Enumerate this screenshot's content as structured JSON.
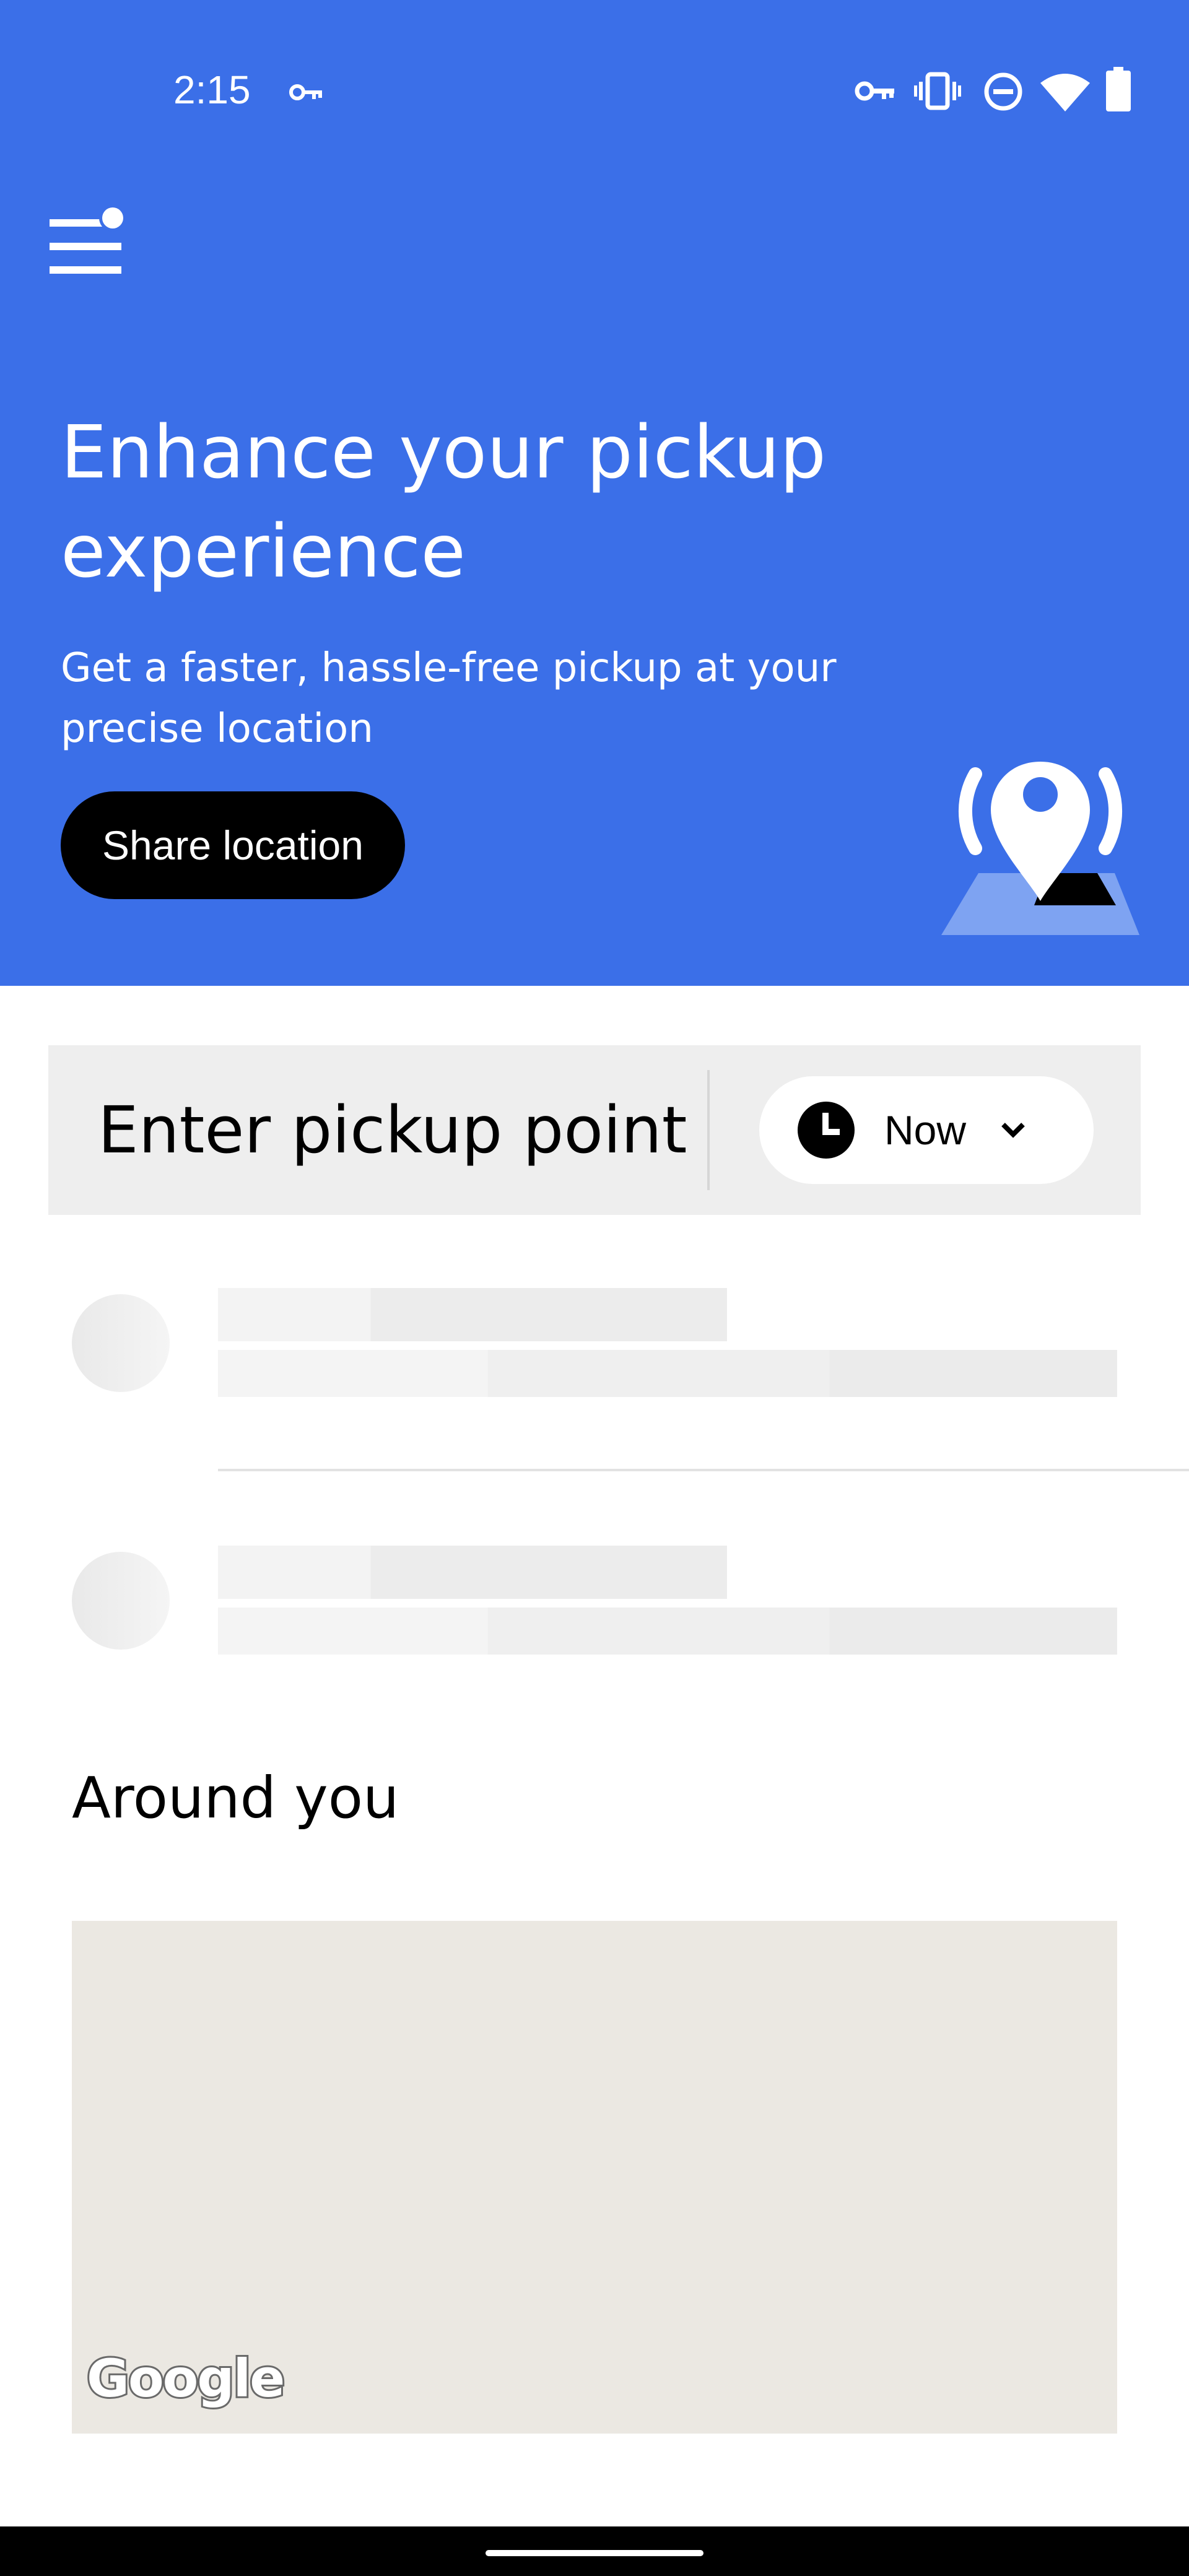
{
  "status_bar": {
    "time": "2:15",
    "icons": [
      "vpn-key-icon",
      "vpn-key-icon",
      "vibrate-icon",
      "do-not-disturb-icon",
      "wifi-icon",
      "battery-icon"
    ]
  },
  "header": {
    "menu_icon": "menu-icon",
    "title": "Enhance your pickup experience",
    "subtitle": "Get a faster, hassle-free pickup at your precise location",
    "share_button_label": "Share location",
    "illustration_icon": "location-pin-icon"
  },
  "pickup": {
    "placeholder": "Enter pickup point",
    "when_label": "Now",
    "when_icon": "clock-icon"
  },
  "around": {
    "title": "Around you",
    "map_attribution": "Google"
  },
  "colors": {
    "hero_blue": "#3B6FE8",
    "map_bg": "#EBE8E2",
    "pickup_bg": "#EEEEEE"
  }
}
